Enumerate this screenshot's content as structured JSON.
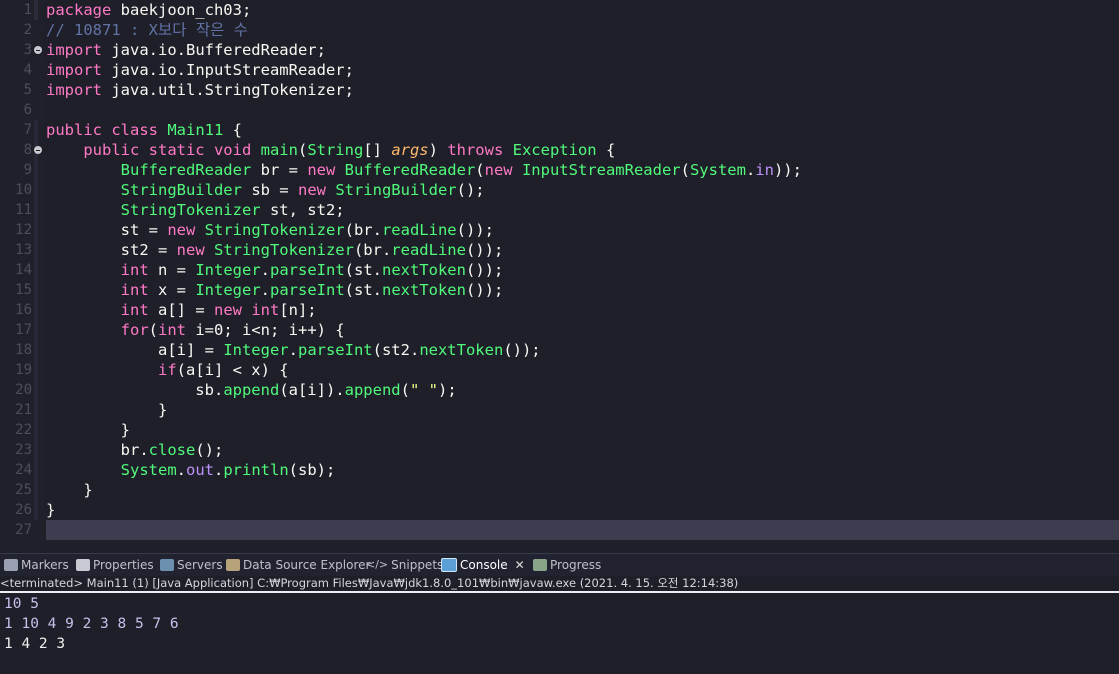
{
  "editor": {
    "line_numbers": [
      "1",
      "2",
      "3",
      "4",
      "5",
      "6",
      "7",
      "8",
      "9",
      "10",
      "11",
      "12",
      "13",
      "14",
      "15",
      "16",
      "17",
      "18",
      "19",
      "20",
      "21",
      "22",
      "23",
      "24",
      "25",
      "26",
      "27"
    ],
    "lines": [
      [
        {
          "t": "package ",
          "c": "kw"
        },
        {
          "t": "baekjoon_ch03;",
          "c": ""
        }
      ],
      [
        {
          "t": "// 10871 : X보다 작은 수",
          "c": "cm"
        }
      ],
      [
        {
          "t": "import ",
          "c": "kw"
        },
        {
          "t": "java.io.BufferedReader;",
          "c": ""
        }
      ],
      [
        {
          "t": "import ",
          "c": "kw"
        },
        {
          "t": "java.io.InputStreamReader;",
          "c": ""
        }
      ],
      [
        {
          "t": "import ",
          "c": "kw"
        },
        {
          "t": "java.util.StringTokenizer;",
          "c": ""
        }
      ],
      [],
      [
        {
          "t": "public class ",
          "c": "kw"
        },
        {
          "t": "Main11",
          "c": "ty"
        },
        {
          "t": " {",
          "c": ""
        }
      ],
      [
        {
          "t": "    public static void ",
          "c": "kw"
        },
        {
          "t": "main",
          "c": "fn"
        },
        {
          "t": "(",
          "c": ""
        },
        {
          "t": "String",
          "c": "ty"
        },
        {
          "t": "[] ",
          "c": ""
        },
        {
          "t": "args",
          "c": "pr"
        },
        {
          "t": ") ",
          "c": ""
        },
        {
          "t": "throws ",
          "c": "kw"
        },
        {
          "t": "Exception",
          "c": "ty"
        },
        {
          "t": " {",
          "c": ""
        }
      ],
      [
        {
          "t": "        ",
          "c": ""
        },
        {
          "t": "BufferedReader",
          "c": "ty"
        },
        {
          "t": " br = ",
          "c": ""
        },
        {
          "t": "new ",
          "c": "kw"
        },
        {
          "t": "BufferedReader",
          "c": "ty"
        },
        {
          "t": "(",
          "c": ""
        },
        {
          "t": "new ",
          "c": "kw"
        },
        {
          "t": "InputStreamReader",
          "c": "ty"
        },
        {
          "t": "(",
          "c": ""
        },
        {
          "t": "System",
          "c": "ty"
        },
        {
          "t": ".",
          "c": ""
        },
        {
          "t": "in",
          "c": "fd"
        },
        {
          "t": "));",
          "c": ""
        }
      ],
      [
        {
          "t": "        ",
          "c": ""
        },
        {
          "t": "StringBuilder",
          "c": "ty"
        },
        {
          "t": " sb = ",
          "c": ""
        },
        {
          "t": "new ",
          "c": "kw"
        },
        {
          "t": "StringBuilder",
          "c": "ty"
        },
        {
          "t": "();",
          "c": ""
        }
      ],
      [
        {
          "t": "        ",
          "c": ""
        },
        {
          "t": "StringTokenizer",
          "c": "ty"
        },
        {
          "t": " st, st2;",
          "c": ""
        }
      ],
      [
        {
          "t": "        st = ",
          "c": ""
        },
        {
          "t": "new ",
          "c": "kw"
        },
        {
          "t": "StringTokenizer",
          "c": "ty"
        },
        {
          "t": "(br.",
          "c": ""
        },
        {
          "t": "readLine",
          "c": "fn"
        },
        {
          "t": "());",
          "c": ""
        }
      ],
      [
        {
          "t": "        st2 = ",
          "c": ""
        },
        {
          "t": "new ",
          "c": "kw"
        },
        {
          "t": "StringTokenizer",
          "c": "ty"
        },
        {
          "t": "(br.",
          "c": ""
        },
        {
          "t": "readLine",
          "c": "fn"
        },
        {
          "t": "());",
          "c": ""
        }
      ],
      [
        {
          "t": "        ",
          "c": ""
        },
        {
          "t": "int",
          "c": "kw"
        },
        {
          "t": " n = ",
          "c": ""
        },
        {
          "t": "Integer",
          "c": "ty"
        },
        {
          "t": ".",
          "c": ""
        },
        {
          "t": "parseInt",
          "c": "fn"
        },
        {
          "t": "(st.",
          "c": ""
        },
        {
          "t": "nextToken",
          "c": "fn"
        },
        {
          "t": "());",
          "c": ""
        }
      ],
      [
        {
          "t": "        ",
          "c": ""
        },
        {
          "t": "int",
          "c": "kw"
        },
        {
          "t": " x = ",
          "c": ""
        },
        {
          "t": "Integer",
          "c": "ty"
        },
        {
          "t": ".",
          "c": ""
        },
        {
          "t": "parseInt",
          "c": "fn"
        },
        {
          "t": "(st.",
          "c": ""
        },
        {
          "t": "nextToken",
          "c": "fn"
        },
        {
          "t": "());",
          "c": ""
        }
      ],
      [
        {
          "t": "        ",
          "c": ""
        },
        {
          "t": "int",
          "c": "kw"
        },
        {
          "t": " a[] = ",
          "c": ""
        },
        {
          "t": "new ",
          "c": "kw"
        },
        {
          "t": "int",
          "c": "kw"
        },
        {
          "t": "[n];",
          "c": ""
        }
      ],
      [
        {
          "t": "        ",
          "c": ""
        },
        {
          "t": "for",
          "c": "kw"
        },
        {
          "t": "(",
          "c": ""
        },
        {
          "t": "int",
          "c": "kw"
        },
        {
          "t": " i=0; i<n; i++) {",
          "c": ""
        }
      ],
      [
        {
          "t": "            a[i] = ",
          "c": ""
        },
        {
          "t": "Integer",
          "c": "ty"
        },
        {
          "t": ".",
          "c": ""
        },
        {
          "t": "parseInt",
          "c": "fn"
        },
        {
          "t": "(st2.",
          "c": ""
        },
        {
          "t": "nextToken",
          "c": "fn"
        },
        {
          "t": "());",
          "c": ""
        }
      ],
      [
        {
          "t": "            ",
          "c": ""
        },
        {
          "t": "if",
          "c": "kw"
        },
        {
          "t": "(a[i] < x) {",
          "c": ""
        }
      ],
      [
        {
          "t": "                sb.",
          "c": ""
        },
        {
          "t": "append",
          "c": "fn"
        },
        {
          "t": "(a[i]).",
          "c": ""
        },
        {
          "t": "append",
          "c": "fn"
        },
        {
          "t": "(",
          "c": ""
        },
        {
          "t": "\" \"",
          "c": "st"
        },
        {
          "t": ");",
          "c": ""
        }
      ],
      [
        {
          "t": "            }",
          "c": ""
        }
      ],
      [
        {
          "t": "        }",
          "c": ""
        }
      ],
      [
        {
          "t": "        br.",
          "c": ""
        },
        {
          "t": "close",
          "c": "fn"
        },
        {
          "t": "();",
          "c": ""
        }
      ],
      [
        {
          "t": "        ",
          "c": ""
        },
        {
          "t": "System",
          "c": "ty"
        },
        {
          "t": ".",
          "c": ""
        },
        {
          "t": "out",
          "c": "fd"
        },
        {
          "t": ".",
          "c": ""
        },
        {
          "t": "println",
          "c": "fn"
        },
        {
          "t": "(sb);",
          "c": ""
        }
      ],
      [
        {
          "t": "    }",
          "c": ""
        }
      ],
      [
        {
          "t": "}",
          "c": ""
        }
      ],
      []
    ]
  },
  "views": {
    "tabs": [
      {
        "label": "Markers",
        "icon": "markers-icon"
      },
      {
        "label": "Properties",
        "icon": "properties-icon"
      },
      {
        "label": "Servers",
        "icon": "servers-icon"
      },
      {
        "label": "Data Source Explorer",
        "icon": "database-icon"
      },
      {
        "label": "Snippets",
        "icon": "snippets-icon"
      },
      {
        "label": "Console",
        "icon": "console-icon",
        "active": true
      },
      {
        "label": "Progress",
        "icon": "progress-icon"
      }
    ],
    "close_glyph": "✕"
  },
  "console": {
    "header": "<terminated> Main11 (1) [Java Application] C:₩Program Files₩Java₩jdk1.8.0_101₩bin₩javaw.exe (2021. 4. 15. 오전 12:14:38)",
    "output": [
      {
        "text": "10 5",
        "color": "#c7c0ec"
      },
      {
        "text": "1 10 4 9 2 3 8 5 7 6",
        "color": "#c7c0ec"
      },
      {
        "text": "1 4 2 3",
        "color": "#f0f0f0"
      }
    ]
  },
  "colors": {
    "background": "#1e1f29",
    "keyword": "#ff79c6",
    "type": "#50fa7b",
    "comment": "#6272a4",
    "param": "#ffb86c",
    "string": "#f1fa8c",
    "field": "#bd93f9"
  }
}
